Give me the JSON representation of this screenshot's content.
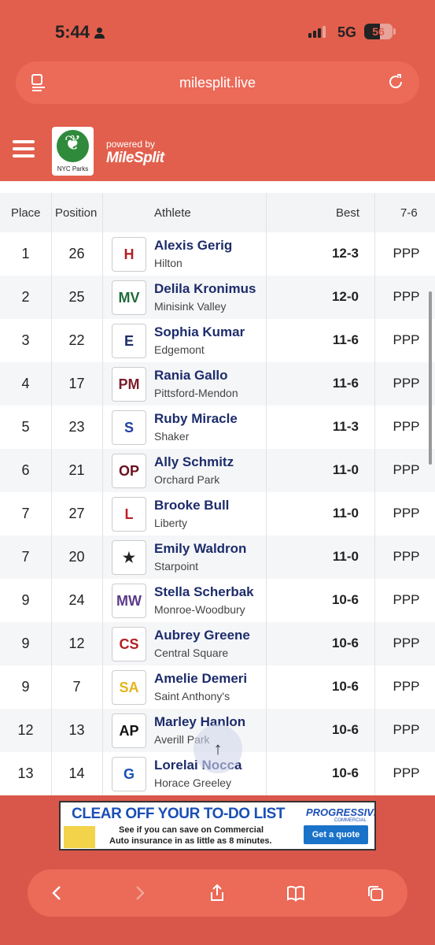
{
  "status": {
    "time": "5:44",
    "network": "5G",
    "battery": "56",
    "battery_level": 0.56
  },
  "browser": {
    "url": "milesplit.live"
  },
  "header": {
    "logo_caption": "NYC Parks",
    "powered_by": "powered by",
    "brand": "MileSplit"
  },
  "table": {
    "columns": {
      "place": "Place",
      "position": "Position",
      "athlete": "Athlete",
      "best": "Best",
      "height": "7-6"
    },
    "rows": [
      {
        "place": "1",
        "position": "26",
        "name": "Alexis Gerig",
        "school": "Hilton",
        "best": "12-3",
        "mark": "PPP",
        "logo_text": "H",
        "logo_color": "#b11f24"
      },
      {
        "place": "2",
        "position": "25",
        "name": "Delila Kronimus",
        "school": "Minisink Valley",
        "best": "12-0",
        "mark": "PPP",
        "logo_text": "MV",
        "logo_color": "#1f6b3a"
      },
      {
        "place": "3",
        "position": "22",
        "name": "Sophia Kumar",
        "school": "Edgemont",
        "best": "11-6",
        "mark": "PPP",
        "logo_text": "E",
        "logo_color": "#1d2c6b"
      },
      {
        "place": "4",
        "position": "17",
        "name": "Rania Gallo",
        "school": "Pittsford-Mendon",
        "best": "11-6",
        "mark": "PPP",
        "logo_text": "PM",
        "logo_color": "#7a1c2a"
      },
      {
        "place": "5",
        "position": "23",
        "name": "Ruby Miracle",
        "school": "Shaker",
        "best": "11-3",
        "mark": "PPP",
        "logo_text": "S",
        "logo_color": "#1d3fa0"
      },
      {
        "place": "6",
        "position": "21",
        "name": "Ally Schmitz",
        "school": "Orchard Park",
        "best": "11-0",
        "mark": "PPP",
        "logo_text": "OP",
        "logo_color": "#6b1020"
      },
      {
        "place": "7",
        "position": "27",
        "name": "Brooke Bull",
        "school": "Liberty",
        "best": "11-0",
        "mark": "PPP",
        "logo_text": "L",
        "logo_color": "#c0202a"
      },
      {
        "place": "7",
        "position": "20",
        "name": "Emily Waldron",
        "school": "Starpoint",
        "best": "11-0",
        "mark": "PPP",
        "logo_text": "★",
        "logo_color": "#222222"
      },
      {
        "place": "9",
        "position": "24",
        "name": "Stella Scherbak",
        "school": "Monroe-Woodbury",
        "best": "10-6",
        "mark": "PPP",
        "logo_text": "MW",
        "logo_color": "#5b3a8a"
      },
      {
        "place": "9",
        "position": "12",
        "name": "Aubrey Greene",
        "school": "Central Square",
        "best": "10-6",
        "mark": "PPP",
        "logo_text": "CS",
        "logo_color": "#b11f24"
      },
      {
        "place": "9",
        "position": "7",
        "name": "Amelie Demeri",
        "school": "Saint Anthony's",
        "best": "10-6",
        "mark": "PPP",
        "logo_text": "SA",
        "logo_color": "#e5b41c"
      },
      {
        "place": "12",
        "position": "13",
        "name": "Marley Hanlon",
        "school": "Averill Park",
        "best": "10-6",
        "mark": "PPP",
        "logo_text": "AP",
        "logo_color": "#111111"
      },
      {
        "place": "13",
        "position": "14",
        "name": "Lorelai Nocca",
        "school": "Horace Greeley",
        "best": "10-6",
        "mark": "PPP",
        "logo_text": "G",
        "logo_color": "#1a4fb5"
      }
    ]
  },
  "ad": {
    "headline": "CLEAR OFF YOUR TO-DO LIST",
    "line1": "See if you can save on Commercial",
    "line2": "Auto insurance in as little as 8 minutes.",
    "brand": "PROGRESSIVE",
    "brand_sub": "COMMERCIAL",
    "cta": "Get a quote"
  },
  "colors": {
    "header_bg": "#e25f4d",
    "name_color": "#1d2c6b",
    "ad_blue": "#1a4fb5"
  }
}
